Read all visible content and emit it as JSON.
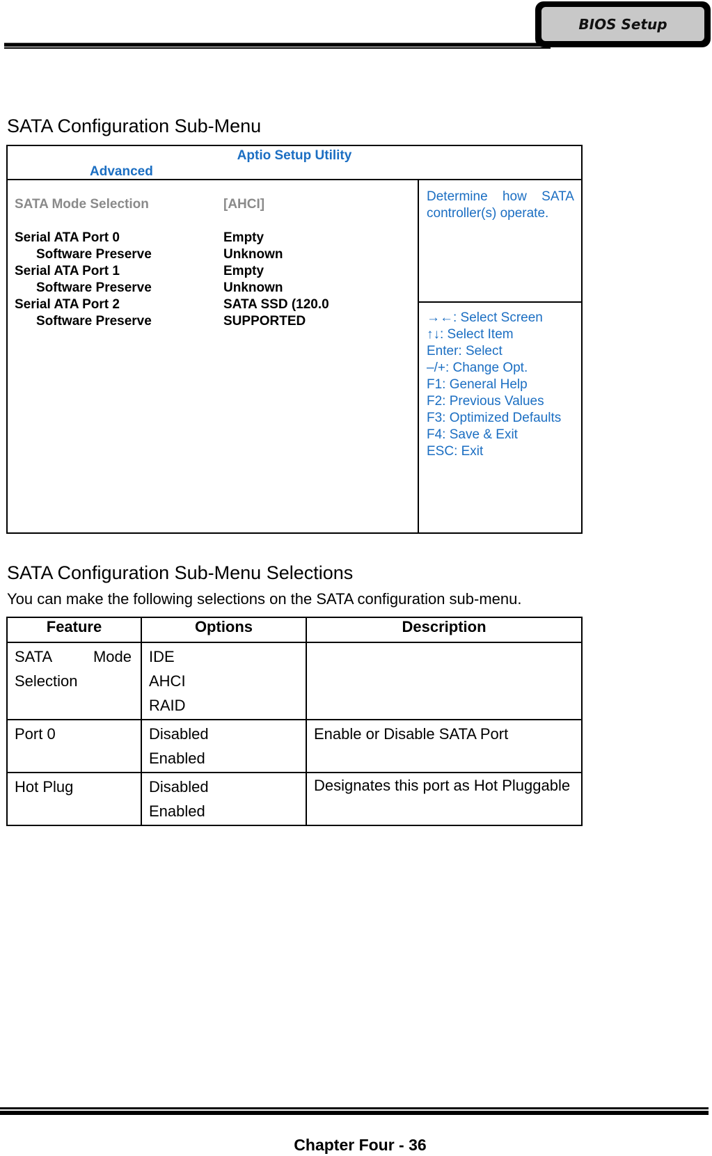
{
  "header": {
    "tab_label": "BIOS Setup"
  },
  "section1": {
    "title": "SATA Configuration Sub-Menu"
  },
  "bios": {
    "title": "Aptio Setup Utility",
    "active_tab": "Advanced",
    "accent_color": "#1b6ec2",
    "items": [
      {
        "label": "SATA Mode Selection",
        "value": "[AHCI]",
        "selectable": true,
        "indent": false
      },
      {
        "label": "Serial ATA Port 0",
        "value": "Empty",
        "indent": false
      },
      {
        "label": "Software Preserve",
        "value": "Unknown",
        "indent": true
      },
      {
        "label": "Serial ATA Port 1",
        "value": "Empty",
        "indent": false
      },
      {
        "label": "Software Preserve",
        "value": "Unknown",
        "indent": true
      },
      {
        "label": "Serial ATA Port 2",
        "value": "SATA SSD (120.0",
        "indent": false
      },
      {
        "label": "Software Preserve",
        "value": "SUPPORTED",
        "indent": true
      }
    ],
    "help_text": "Determine how SATA controller(s) operate.",
    "keys": [
      "→←: Select Screen",
      "↑↓: Select Item",
      "Enter: Select",
      "–/+: Change Opt.",
      "F1: General Help",
      "F2: Previous Values",
      "F3: Optimized Defaults",
      "F4: Save & Exit",
      "ESC: Exit"
    ]
  },
  "section2": {
    "title": "SATA Configuration Sub-Menu Selections",
    "description": "You can make the following selections on the SATA configuration sub-menu.",
    "table": {
      "headers": [
        "Feature",
        "Options",
        "Description"
      ],
      "rows": [
        {
          "feature": "SATA Mode Selection",
          "options": [
            "IDE",
            "AHCI",
            "RAID"
          ],
          "description": ""
        },
        {
          "feature": "Port 0",
          "options": [
            "Disabled",
            "Enabled"
          ],
          "description": "Enable or Disable SATA Port"
        },
        {
          "feature": "Hot Plug",
          "options": [
            "Disabled",
            "Enabled"
          ],
          "description": "Designates this port as Hot Pluggable"
        }
      ]
    }
  },
  "footer": {
    "text": "Chapter Four - 36"
  }
}
